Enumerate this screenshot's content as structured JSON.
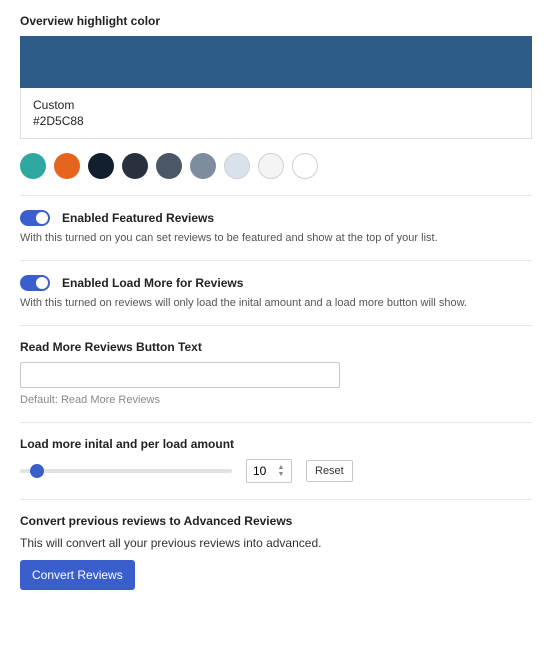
{
  "highlight": {
    "title": "Overview highlight color",
    "preview_color": "#2D5C88",
    "name": "Custom",
    "hex": "#2D5C88",
    "swatches": [
      {
        "color": "#2FA7A1",
        "outlined": false
      },
      {
        "color": "#E6631E",
        "outlined": false
      },
      {
        "color": "#121F2E",
        "outlined": false
      },
      {
        "color": "#29313F",
        "outlined": false
      },
      {
        "color": "#4B5766",
        "outlined": false
      },
      {
        "color": "#7E8CA0",
        "outlined": false
      },
      {
        "color": "#D9E2EC",
        "outlined": true
      },
      {
        "color": "#F2F4F6",
        "outlined": true
      },
      {
        "color": "#FFFFFF",
        "outlined": true
      }
    ]
  },
  "featured": {
    "label": "Enabled Featured Reviews",
    "hint": "With this turned on you can set reviews to be featured and show at the top of your list.",
    "on": true
  },
  "loadmore_toggle": {
    "label": "Enabled Load More for Reviews",
    "hint": "With this turned on reviews will only load the inital amount and a load more button will show.",
    "on": true
  },
  "button_text": {
    "label": "Read More Reviews Button Text",
    "value": "",
    "default_hint": "Default: Read More Reviews"
  },
  "load_amount": {
    "label": "Load more inital and per load amount",
    "value": "10",
    "reset": "Reset"
  },
  "convert": {
    "title": "Convert previous reviews to Advanced Reviews",
    "desc": "This will convert all your previous reviews into advanced.",
    "button": "Convert Reviews"
  }
}
